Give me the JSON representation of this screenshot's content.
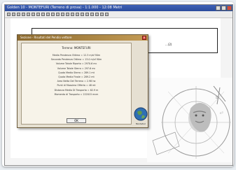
{
  "app": {
    "title": "Golden 10 - MONTEFURI (Terreno di prova) - 1:1.000 - 12:08 Metri"
  },
  "toolbar": {
    "icons": [
      "new-icon",
      "open-icon",
      "save-icon",
      "print-icon",
      "cut-icon",
      "copy-icon",
      "paste-icon",
      "undo-icon",
      "redo-icon",
      "zoom-in-icon",
      "zoom-out-icon",
      "pan-icon",
      "select-icon",
      "line-icon",
      "polygon-icon",
      "measure-icon",
      "layers-icon",
      "table-icon",
      "chart-icon",
      "settings-icon",
      "help-icon"
    ]
  },
  "document": {
    "note": "...(2)"
  },
  "dialog": {
    "title": "Sezione · Risultati del Pendio vettore",
    "terrain_label": "Terreno: MONTEFURI",
    "rows": [
      "Media Pendenza Ottima = 12.3 m/sf 90m",
      "Seconda Pendenza Ottima = 13.0 m/sf 90m",
      "Volume Totale Riporto = 2970.6 mc",
      "Volume Totale Sterro = 297.6 mc",
      "Quota Media Sterro = 289.1 mt",
      "Quota Media Finale = 289.2 mt",
      "Area Netta Del Terreno = 2.98 ha",
      "Punti di Massima Offerta = 48 mt",
      "Distanza Media Di Trasporto = 62.9 m",
      "Momento di Trasporto = 222015 mcm"
    ],
    "ok_label": "OK",
    "globe_label": "Montefuri"
  },
  "colors": {
    "dialog_title": "#8c6a2f",
    "app_title": "#2a4b9b",
    "close": "#d6443a"
  }
}
